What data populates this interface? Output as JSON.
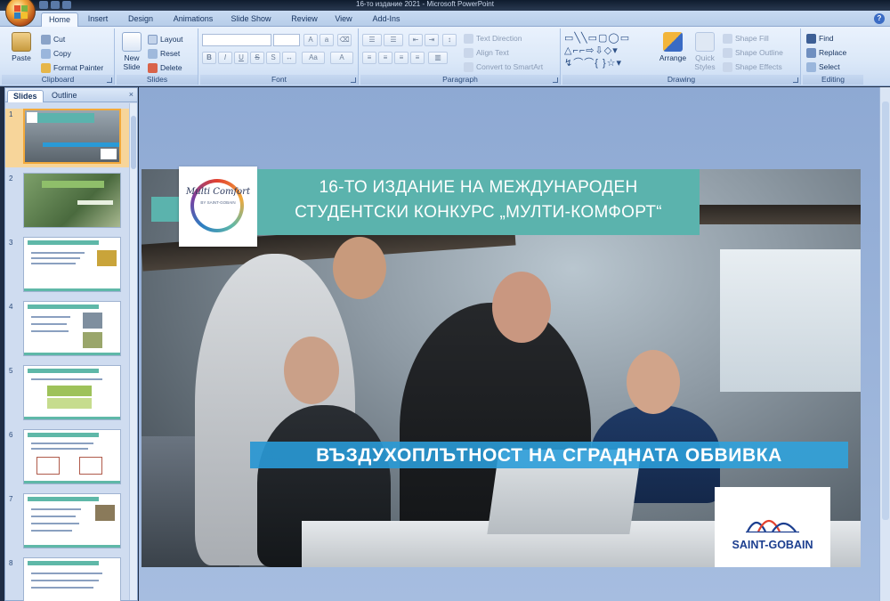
{
  "window": {
    "title": "16-то издание 2021 - Microsoft PowerPoint"
  },
  "ribbon": {
    "tabs": [
      "Home",
      "Insert",
      "Design",
      "Animations",
      "Slide Show",
      "Review",
      "View",
      "Add-Ins"
    ],
    "active_tab": "Home",
    "clipboard": {
      "paste": "Paste",
      "cut": "Cut",
      "copy": "Copy",
      "format_painter": "Format Painter",
      "label": "Clipboard"
    },
    "slides": {
      "new_slide": "New Slide",
      "layout": "Layout",
      "reset": "Reset",
      "delete": "Delete",
      "label": "Slides"
    },
    "font": {
      "label": "Font"
    },
    "paragraph": {
      "text_direction": "Text Direction",
      "align_text": "Align Text",
      "convert_smartart": "Convert to SmartArt",
      "label": "Paragraph"
    },
    "drawing": {
      "arrange": "Arrange",
      "quick_styles": "Quick Styles",
      "shape_fill": "Shape Fill",
      "shape_outline": "Shape Outline",
      "shape_effects": "Shape Effects",
      "label": "Drawing"
    },
    "editing": {
      "find": "Find",
      "replace": "Replace",
      "select": "Select",
      "label": "Editing"
    }
  },
  "left_pane": {
    "tabs": [
      "Slides",
      "Outline"
    ],
    "active_tab": "Slides",
    "close": "×",
    "slide_numbers": [
      "1",
      "2",
      "3",
      "4",
      "5",
      "6",
      "7",
      "8"
    ],
    "selected": "1"
  },
  "slide": {
    "logo_text": "Multi Comfort",
    "logo_sub": "BY SAINT-GOBAIN",
    "title_line1": "16-ТО ИЗДАНИЕ НА МЕЖДУНАРОДЕН",
    "title_line2": "СТУДЕНТСКИ КОНКУРС „МУЛТИ-КОМФОРТ“",
    "subtitle": "ВЪЗДУХОПЛЪТНОСТ НА СГРАДНАТА ОБВИВКА",
    "brand": "SAINT-GOBAIN"
  },
  "colors": {
    "teal_band": "#5bb3ad",
    "blue_band": "#2a9ad6",
    "brand_blue": "#1b3e8f"
  }
}
